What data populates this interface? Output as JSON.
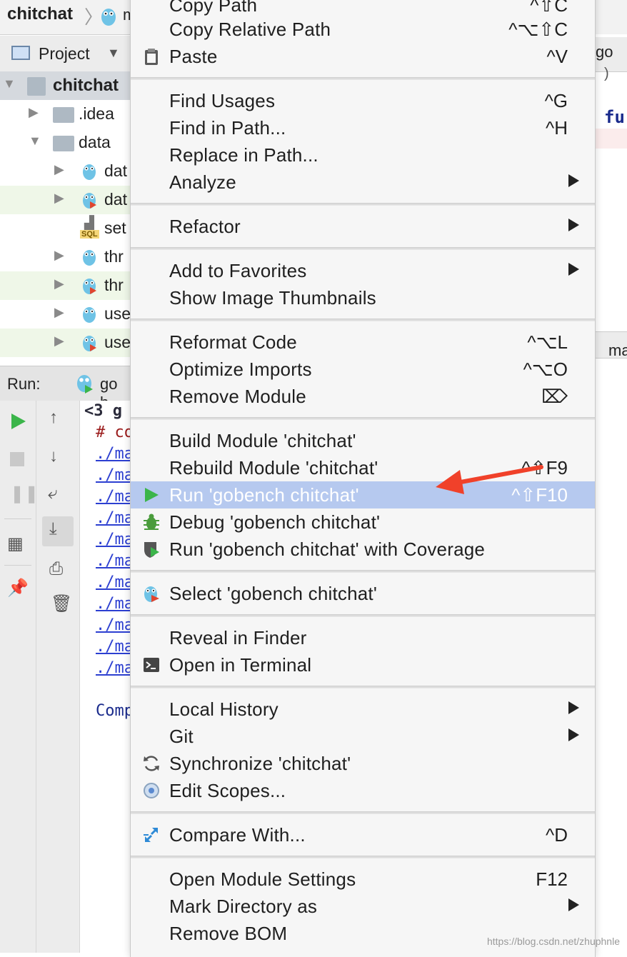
{
  "window": {
    "breadcrumb_project": "chitchat",
    "breadcrumb_next": "m"
  },
  "project_panel": {
    "title": "Project",
    "root": "chitchat",
    "items": [
      {
        "label": ".idea"
      },
      {
        "label": "data"
      },
      {
        "label": "dat"
      },
      {
        "label": "dat"
      },
      {
        "label": "set"
      },
      {
        "label": "thr"
      },
      {
        "label": "thr"
      },
      {
        "label": "use"
      },
      {
        "label": "use"
      }
    ],
    "sql_badge": "SQL"
  },
  "run_panel": {
    "label": "Run:",
    "tab_label": "go b",
    "console_lines": [
      "<3 g",
      "# co",
      "./ma",
      "./ma",
      "./ma",
      "./ma",
      "./ma",
      "./ma",
      "./ma",
      "./ma",
      "./ma",
      "./ma",
      "./ma",
      "Comp"
    ]
  },
  "editor": {
    "tab_label": "go",
    "keyword": "fur",
    "bottom_tab": "ma",
    "paren": ")"
  },
  "menu": {
    "items": [
      {
        "label": "Copy Path",
        "shortcut": "^⇧C"
      },
      {
        "label": "Copy Relative Path",
        "shortcut": "^⌥⇧C"
      },
      {
        "label": "Paste",
        "shortcut": "^V",
        "icon": "clipboard-icon"
      },
      {
        "label": "Find Usages",
        "shortcut": "^G"
      },
      {
        "label": "Find in Path...",
        "shortcut": "^H"
      },
      {
        "label": "Replace in Path...",
        "shortcut": ""
      },
      {
        "label": "Analyze",
        "submenu": true
      },
      {
        "label": "Refactor",
        "submenu": true
      },
      {
        "label": "Add to Favorites",
        "submenu": true
      },
      {
        "label": "Show Image Thumbnails",
        "shortcut": ""
      },
      {
        "label": "Reformat Code",
        "shortcut": "^⌥L"
      },
      {
        "label": "Optimize Imports",
        "shortcut": "^⌥O"
      },
      {
        "label": "Remove Module",
        "shortcut": "⌦"
      },
      {
        "label": "Build Module 'chitchat'",
        "shortcut": ""
      },
      {
        "label": "Rebuild Module 'chitchat'",
        "shortcut": "^⇧F9"
      },
      {
        "label": "Run 'gobench chitchat'",
        "shortcut": "^⇧F10",
        "icon": "run-icon"
      },
      {
        "label": "Debug 'gobench chitchat'",
        "shortcut": "",
        "icon": "debug-bug-icon"
      },
      {
        "label": "Run 'gobench chitchat' with Coverage",
        "shortcut": "",
        "icon": "coverage-shield-icon"
      },
      {
        "label": "Select 'gobench chitchat'",
        "shortcut": "",
        "icon": "gopher-config-icon"
      },
      {
        "label": "Reveal in Finder",
        "shortcut": ""
      },
      {
        "label": "Open in Terminal",
        "shortcut": "",
        "icon": "terminal-icon"
      },
      {
        "label": "Local History",
        "submenu": true
      },
      {
        "label": "Git",
        "submenu": true
      },
      {
        "label": "Synchronize 'chitchat'",
        "shortcut": "",
        "icon": "sync-icon"
      },
      {
        "label": "Edit Scopes...",
        "shortcut": "",
        "icon": "scope-target-icon"
      },
      {
        "label": "Compare With...",
        "shortcut": "^D",
        "icon": "compare-arrows-icon"
      },
      {
        "label": "Open Module Settings",
        "shortcut": "F12"
      },
      {
        "label": "Mark Directory as",
        "submenu": true
      },
      {
        "label": "Remove BOM",
        "shortcut": ""
      }
    ]
  },
  "colors": {
    "highlight": "#b6c9ef",
    "menu_bg": "#f6f6f6",
    "annotation_arrow": "#f0412a",
    "run_green": "#3bb54a"
  },
  "watermark": "https://blog.csdn.net/zhuphnle"
}
